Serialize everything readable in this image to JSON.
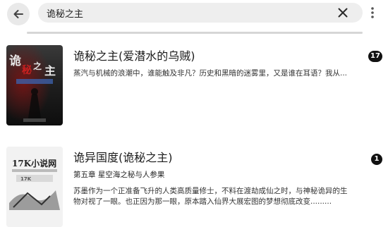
{
  "search": {
    "value": "诡秘之主",
    "placeholder": ""
  },
  "results": [
    {
      "title": "诡秘之主(爱潜水的乌贼)",
      "description": "蒸汽与机械的浪潮中，谁能触及非凡？历史和黑暗的迷雾里，又是谁在耳语？我从...",
      "badge": "17",
      "cover_text": "诡秘之主"
    },
    {
      "title": "诡异国度(诡秘之主)",
      "chapter": "第五章 星空海之秘与人参果",
      "description_line1": "苏墨作为一个正准备飞升的人类高质量修士，不料在渡劫成仙之时，与神秘诡异的生",
      "description_line2": "物对视了一眼。也正因为那一眼，原本踏入仙界大展宏图的梦想彻底改变.........",
      "badge": "1",
      "cover_text": "17K小说网"
    }
  ]
}
